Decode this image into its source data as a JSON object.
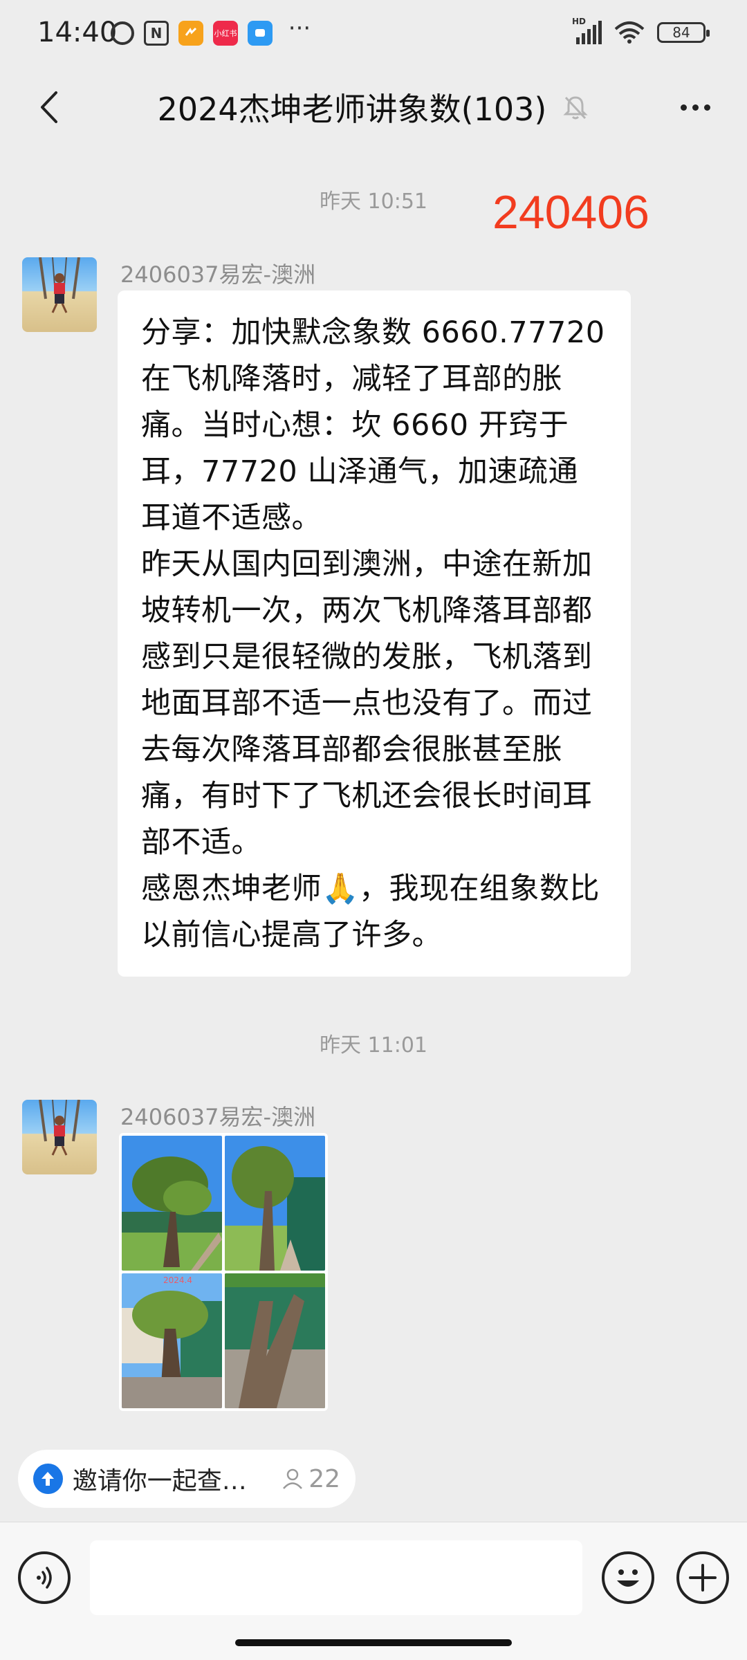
{
  "status_bar": {
    "time": "14:40",
    "red_app_label": "小红书",
    "battery": "84"
  },
  "header": {
    "title": "2024杰坤老师讲象数(103)"
  },
  "chat": {
    "annotation": "240406",
    "messages": [
      {
        "timestamp": "昨天 10:51",
        "sender": "2406037易宏-澳洲",
        "text": "分享：加快默念象数 6660.77720 在飞机降落时，减轻了耳部的胀痛。当时心想：坎 6660 开窍于耳，77720 山泽通气，加速疏通耳道不适感。\n昨天从国内回到澳洲，中途在新加坡转机一次，两次飞机降落耳部都感到只是很轻微的发胀，飞机落到地面耳部不适一点也没有了。而过去每次降落耳部都会很胀甚至胀痛，有时下了飞机还会很长时间耳部不适。\n感恩杰坤老师🙏，我现在组象数比以前信心提高了许多。"
      },
      {
        "timestamp": "昨天 11:01",
        "sender": "2406037易宏-澳洲",
        "photo_watermark": "2024.4"
      }
    ]
  },
  "invite": {
    "text": "邀请你一起查…",
    "count": "22"
  },
  "input": {
    "value": ""
  },
  "colors": {
    "background": "#ededed",
    "annotation": "#f23c1f",
    "invite_icon": "#1976e6"
  }
}
